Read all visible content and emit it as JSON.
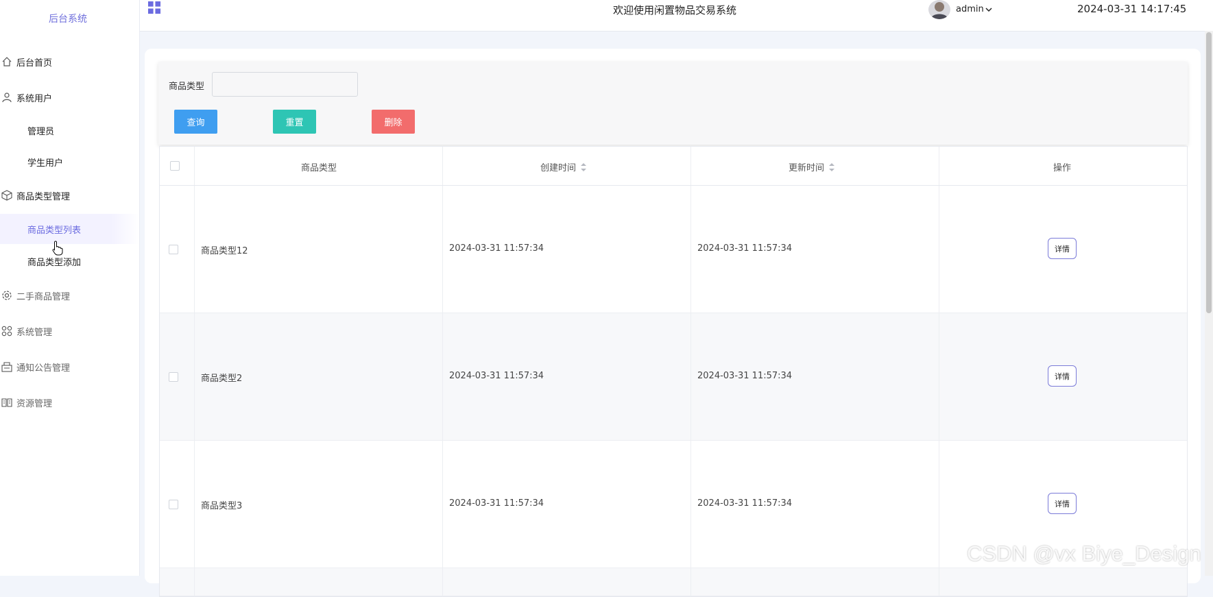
{
  "sidebar": {
    "brand": "后台系统",
    "items": [
      {
        "label": "后台首页",
        "icon": "home-icon"
      },
      {
        "label": "系统用户",
        "icon": "user-icon"
      },
      {
        "label": "管理员"
      },
      {
        "label": "学生用户"
      },
      {
        "label": "商品类型管理",
        "icon": "box-icon"
      },
      {
        "label": "商品类型列表",
        "active": true
      },
      {
        "label": "商品类型添加"
      },
      {
        "label": "二手商品管理",
        "icon": "gear-icon"
      },
      {
        "label": "系统管理",
        "icon": "apps-icon"
      },
      {
        "label": "通知公告管理",
        "icon": "notice-icon"
      },
      {
        "label": "资源管理",
        "icon": "book-icon"
      }
    ]
  },
  "header": {
    "title": "欢迎使用闲置物品交易系统",
    "user": "admin",
    "datetime": "2024-03-31 14:17:45"
  },
  "search": {
    "label": "商品类型",
    "value": "",
    "query_label": "查询",
    "reset_label": "重置",
    "delete_label": "删除"
  },
  "table": {
    "headers": [
      "商品类型",
      "创建时间",
      "更新时间",
      "操作"
    ],
    "rows": [
      {
        "type": "商品类型12",
        "created": "2024-03-31 11:57:34",
        "updated": "2024-03-31 11:57:34",
        "action": "详情"
      },
      {
        "type": "商品类型2",
        "created": "2024-03-31 11:57:34",
        "updated": "2024-03-31 11:57:34",
        "action": "详情"
      },
      {
        "type": "商品类型3",
        "created": "2024-03-31 11:57:34",
        "updated": "2024-03-31 11:57:34",
        "action": "详情"
      }
    ]
  },
  "watermark": "CSDN @vx Biye_Design",
  "colors": {
    "accent": "#6b6be0",
    "query": "#3f9ef0",
    "reset": "#2ec5b4",
    "delete": "#f26c6c"
  }
}
